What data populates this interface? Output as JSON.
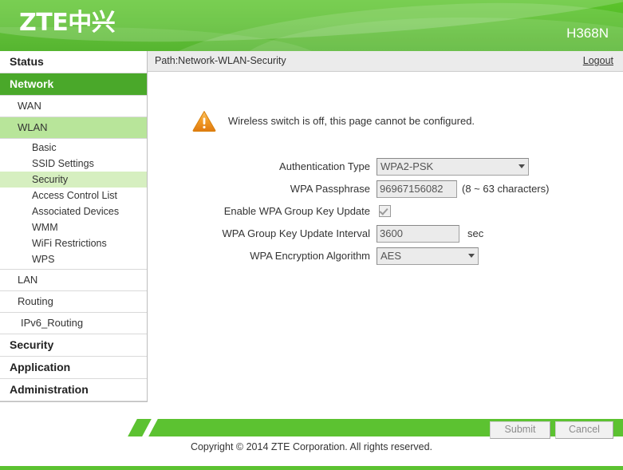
{
  "header": {
    "logo_text": "ZTE中兴",
    "model": "H368N"
  },
  "pathbar": {
    "path": "Path:Network-WLAN-Security",
    "logout": "Logout"
  },
  "sidebar": {
    "items": [
      {
        "label": "Status",
        "level": "top",
        "active": false
      },
      {
        "label": "Network",
        "level": "top",
        "active": true
      },
      {
        "label": "WAN",
        "level": "sub",
        "active": false
      },
      {
        "label": "WLAN",
        "level": "sub",
        "active": true
      },
      {
        "label": "Basic",
        "level": "leaf",
        "active": false
      },
      {
        "label": "SSID Settings",
        "level": "leaf",
        "active": false
      },
      {
        "label": "Security",
        "level": "leaf",
        "active": true
      },
      {
        "label": "Access Control List",
        "level": "leaf",
        "active": false
      },
      {
        "label": "Associated Devices",
        "level": "leaf",
        "active": false
      },
      {
        "label": "WMM",
        "level": "leaf",
        "active": false
      },
      {
        "label": "WiFi Restrictions",
        "level": "leaf",
        "active": false
      },
      {
        "label": "WPS",
        "level": "leaf",
        "active": false
      },
      {
        "label": "LAN",
        "level": "sub",
        "active": false
      },
      {
        "label": "Routing",
        "level": "sub",
        "active": false
      },
      {
        "label": "IPv6_Routing",
        "level": "sub2",
        "active": false
      },
      {
        "label": "Security",
        "level": "top",
        "active": false
      },
      {
        "label": "Application",
        "level": "top",
        "active": false
      },
      {
        "label": "Administration",
        "level": "top",
        "active": false
      }
    ]
  },
  "notice": {
    "icon": "warning-triangle-icon",
    "message": "Wireless switch is off, this page cannot be configured."
  },
  "form": {
    "auth_type": {
      "label": "Authentication Type",
      "value": "WPA2-PSK",
      "options": [
        "WPA2-PSK"
      ]
    },
    "passphrase": {
      "label": "WPA Passphrase",
      "value": "96967156082",
      "hint": "(8 ~ 63 characters)"
    },
    "group_key_update": {
      "label": "Enable WPA Group Key Update",
      "checked": true
    },
    "group_key_interval": {
      "label": "WPA Group Key Update Interval",
      "value": "3600",
      "unit": "sec"
    },
    "encryption_algorithm": {
      "label": "WPA Encryption Algorithm",
      "value": "AES",
      "options": [
        "AES"
      ]
    }
  },
  "actions": {
    "submit": "Submit",
    "cancel": "Cancel"
  },
  "footer": {
    "copyright": "Copyright © 2014 ZTE Corporation. All rights reserved."
  },
  "colors": {
    "brand_green": "#5cc231",
    "active_nav_green": "#4aa82a",
    "sub_active_green": "#b8e59a",
    "leaf_active_green": "#d6efc0",
    "warning_orange": "#f0922b",
    "pathbar_gray": "#ebebeb"
  }
}
